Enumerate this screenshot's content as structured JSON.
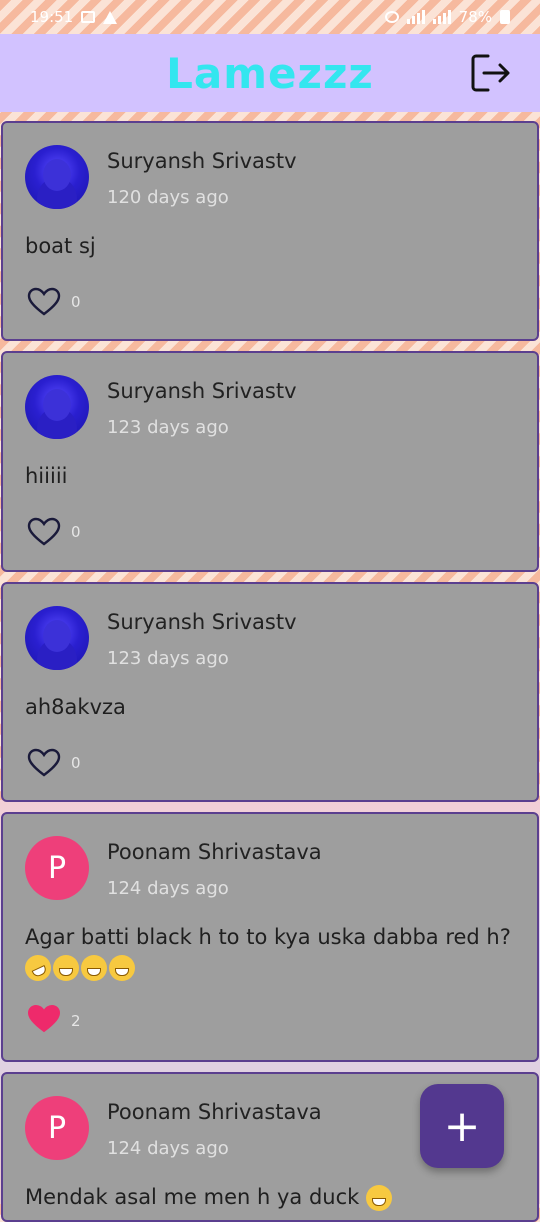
{
  "status_bar": {
    "time": "19:51",
    "battery": "78%"
  },
  "app_bar": {
    "title": "Lamezzz",
    "logout_icon": "logout-icon"
  },
  "posts": [
    {
      "author": "Suryansh Srivastv",
      "time": "120 days ago",
      "text": "boat sj",
      "likes": "0",
      "liked": false,
      "avatar_type": "photo"
    },
    {
      "author": "Suryansh Srivastv",
      "time": "123 days ago",
      "text": "hiiiii",
      "likes": "0",
      "liked": false,
      "avatar_type": "photo"
    },
    {
      "author": "Suryansh Srivastv",
      "time": "123 days ago",
      "text": "ah8akvza",
      "likes": "0",
      "liked": false,
      "avatar_type": "photo"
    },
    {
      "author": "Poonam Shrivastava",
      "avatar_letter": "P",
      "time": "124 days ago",
      "text": "Agar batti black h to to kya uska dabba red h?",
      "likes": "2",
      "liked": true,
      "avatar_type": "letter"
    },
    {
      "author": "Poonam Shrivastava",
      "avatar_letter": "P",
      "time": "124 days ago",
      "text": "Mendak asal me men h ya duck",
      "likes": "",
      "liked": false,
      "avatar_type": "letter"
    }
  ],
  "fab": {
    "label": "+"
  },
  "colors": {
    "app_bar": "#d2c2ff",
    "title": "#33e6ef",
    "card": "#9e9e9e",
    "card_border": "#5b3f8f",
    "heart_liked": "#ee2a6b",
    "fab": "#53388f"
  }
}
